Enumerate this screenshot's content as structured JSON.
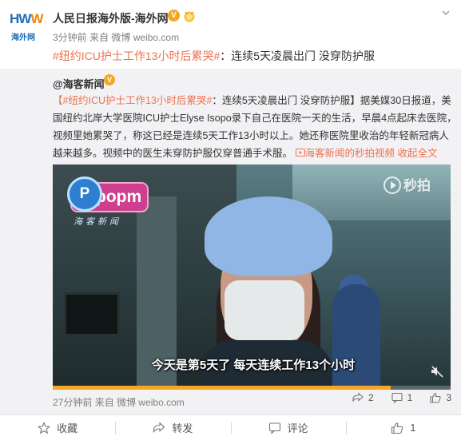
{
  "account": {
    "name": "人民日报海外版-海外网",
    "avatar_logo": "HWW",
    "avatar_site": "海外网"
  },
  "meta": {
    "time": "3分钟前",
    "from_label": "来自",
    "source": "微博 weibo.com"
  },
  "post": {
    "hashtag": "#纽约ICU护士工作13小时后累哭#",
    "text": "：连续5天凌晨出门 没穿防护服"
  },
  "repost": {
    "author": "@海客新闻",
    "hashtag": "#纽约ICU护士工作13小时后累哭#",
    "body": "：连续5天凌晨出门 没穿防护服】据美媒30日报道，美国纽约北岸大学医院ICU护士Elyse Isopo录下自己在医院一天的生活，早晨4点起床去医院，视频里她累哭了，称这已经是连续5天工作13小时以上。她还称医院里收治的年轻新冠病人越来越多。视频中的医生未穿防护服仅穿普通手术服。",
    "video_link": "海客新闻的秒拍视频",
    "collapse_link": "收起全文",
    "bracket_open": "【",
    "video": {
      "logo_text": "popm",
      "logo_circle": "P",
      "logo_sub": "海客新闻",
      "watermark": "秒拍",
      "subtitle": "今天是第5天了 每天连续工作13个小时",
      "progress": 0.85
    },
    "meta_time": "27分钟前",
    "meta_from": "来自",
    "meta_source": "微博 weibo.com",
    "shares": "2",
    "comments": "1",
    "likes": "3"
  },
  "actions": {
    "collect": "收藏",
    "repost": "转发",
    "comment": "评论",
    "like": "1"
  },
  "colors": {
    "accent": "#eb7350",
    "badge": "#f5a623"
  }
}
